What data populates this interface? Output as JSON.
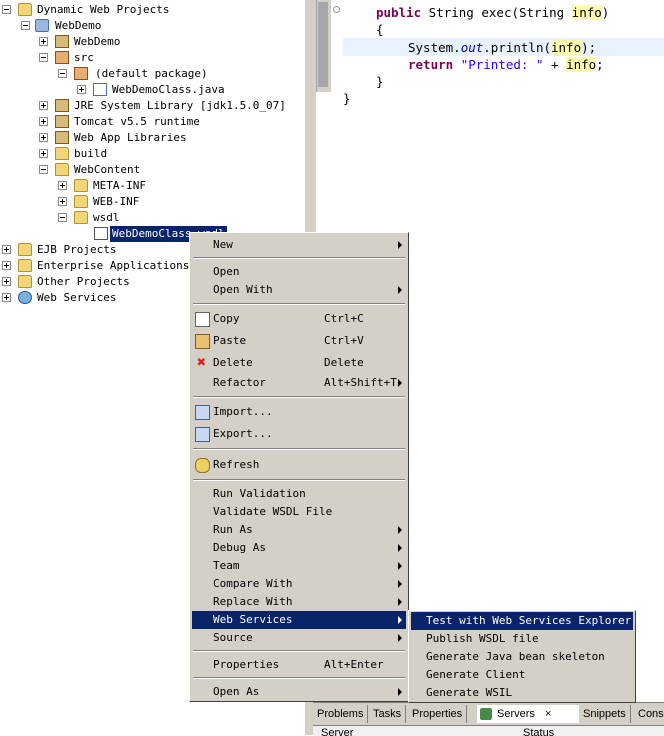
{
  "tree": {
    "items": [
      {
        "label": "Dynamic Web Projects",
        "exp": "minus",
        "icon": "folder"
      },
      {
        "label": "WebDemo",
        "exp": "minus",
        "icon": "proj"
      },
      {
        "label": "WebDemo",
        "exp": "plus",
        "icon": "jar"
      },
      {
        "label": "src",
        "exp": "minus",
        "icon": "folder"
      },
      {
        "label": "(default package)",
        "exp": "minus",
        "icon": "pkg"
      },
      {
        "label": "WebDemoClass.java",
        "exp": "plus",
        "icon": "java"
      },
      {
        "label": "JRE System Library [jdk1.5.0_07]",
        "exp": "plus",
        "icon": "jar"
      },
      {
        "label": "Tomcat v5.5 runtime",
        "exp": "plus",
        "icon": "jar"
      },
      {
        "label": "Web App Libraries",
        "exp": "plus",
        "icon": "jar"
      },
      {
        "label": "build",
        "exp": "plus",
        "icon": "folder"
      },
      {
        "label": "WebContent",
        "exp": "minus",
        "icon": "folder"
      },
      {
        "label": "META-INF",
        "exp": "plus",
        "icon": "folder"
      },
      {
        "label": "WEB-INF",
        "exp": "plus",
        "icon": "folder"
      },
      {
        "label": "wsdl",
        "exp": "minus",
        "icon": "folder"
      },
      {
        "label": "WebDemoClass.wsdl",
        "exp": "none",
        "icon": "xml"
      },
      {
        "label": "EJB Projects",
        "exp": "plus",
        "icon": "folder"
      },
      {
        "label": "Enterprise Applications",
        "exp": "plus",
        "icon": "folder"
      },
      {
        "label": "Other Projects",
        "exp": "plus",
        "icon": "folder"
      },
      {
        "label": "Web Services",
        "exp": "plus",
        "icon": "ws"
      }
    ]
  },
  "editor": {
    "line1": {
      "kw": "public",
      "mid": " String exec(String ",
      "hl": "info",
      "end": ")"
    },
    "line2": "{",
    "line3": {
      "pre": "System.",
      "it": "out",
      "mid": ".println(",
      "hl": "info",
      "end": ");"
    },
    "line4": {
      "kw": "return",
      "str": "\"Printed: \"",
      "mid": " + ",
      "hl": "info",
      "end": ";"
    },
    "line5": "}",
    "line6": "}"
  },
  "menu": {
    "new": "New",
    "open": "Open",
    "open_with": "Open With",
    "copy": "Copy",
    "copy_sc": "Ctrl+C",
    "paste": "Paste",
    "paste_sc": "Ctrl+V",
    "delete": "Delete",
    "delete_sc": "Delete",
    "refactor": "Refactor",
    "refactor_sc": "Alt+Shift+T",
    "import": "Import...",
    "export": "Export...",
    "refresh": "Refresh",
    "run_validation": "Run Validation",
    "validate_wsdl": "Validate WSDL File",
    "run_as": "Run As",
    "debug_as": "Debug As",
    "team": "Team",
    "compare_with": "Compare With",
    "replace_with": "Replace With",
    "web_services": "Web Services",
    "source": "Source",
    "properties": "Properties",
    "properties_sc": "Alt+Enter",
    "open_as": "Open As"
  },
  "submenu": {
    "items": [
      "Test with Web Services Explorer",
      "Publish WSDL file",
      "Generate Java bean skeleton",
      "Generate Client",
      "Generate WSIL"
    ]
  },
  "panel": {
    "tabs": [
      "Problems",
      "Tasks",
      "Properties",
      "Servers",
      "Snippets",
      "Cons"
    ],
    "col_server": "Server",
    "col_status": "Status"
  },
  "colors": {
    "selection": "#0a246a",
    "menu_bg": "#d4d0c8",
    "keyword": "#7f0055",
    "string": "#2a00ff"
  }
}
